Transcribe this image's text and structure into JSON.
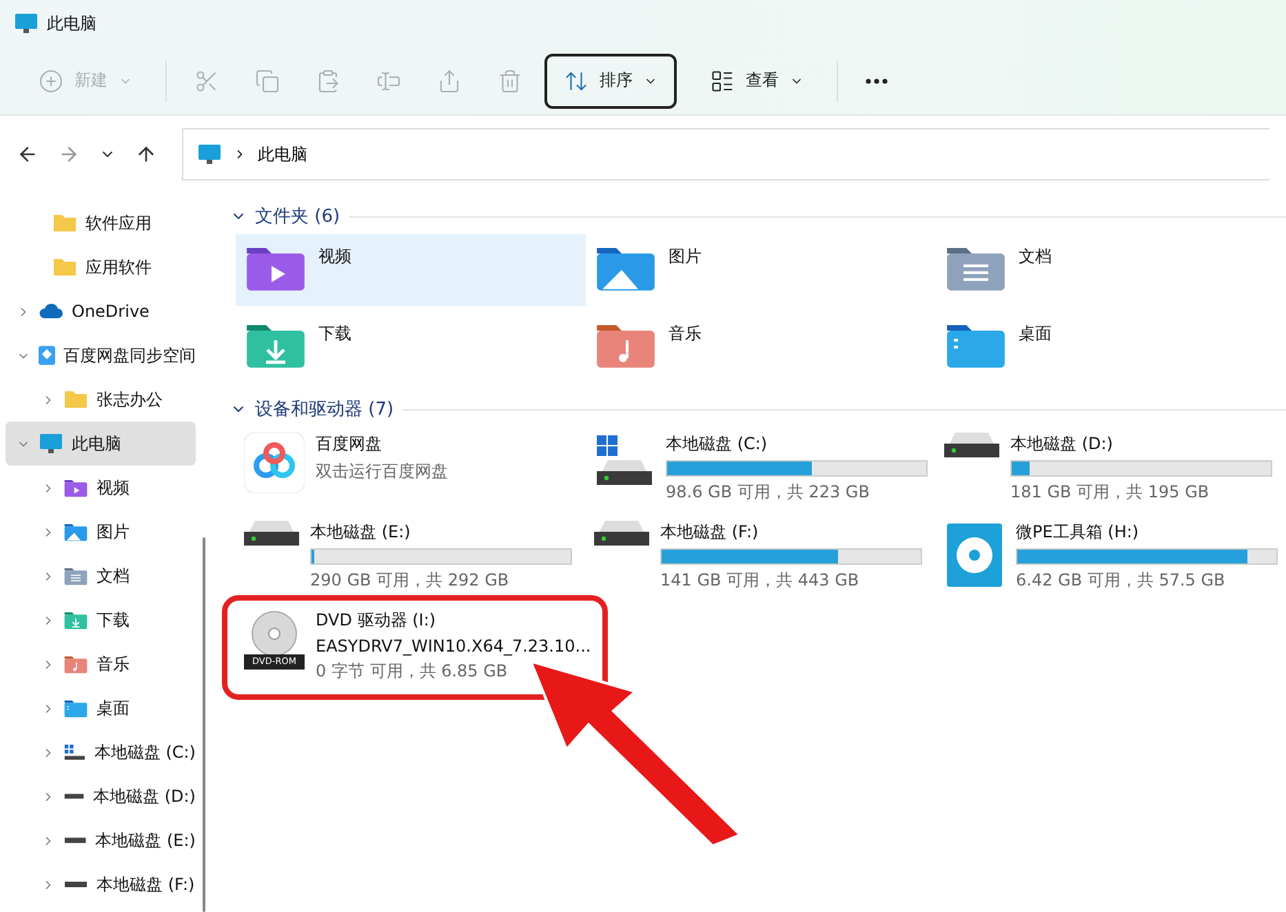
{
  "window": {
    "title": "此电脑"
  },
  "toolbar": [
    {
      "kind": "new",
      "label": "新建",
      "disabled": true,
      "selected": false
    },
    {
      "kind": "cut",
      "disabled": true,
      "selected": false
    },
    {
      "kind": "copy",
      "disabled": true,
      "selected": false
    },
    {
      "kind": "paste",
      "disabled": true,
      "selected": false
    },
    {
      "kind": "rename",
      "disabled": true,
      "selected": false
    },
    {
      "kind": "share",
      "disabled": true,
      "selected": false
    },
    {
      "kind": "delete",
      "disabled": true,
      "selected": false
    },
    {
      "kind": "sort",
      "label": "排序",
      "disabled": false,
      "selected": true
    },
    {
      "kind": "view",
      "label": "查看",
      "disabled": false,
      "selected": false
    },
    {
      "kind": "more",
      "disabled": false,
      "selected": false
    }
  ],
  "address": {
    "path": [
      "此电脑"
    ]
  },
  "sidebar": {
    "continued_items": [
      {
        "label": "软件应用",
        "kind": "folder"
      },
      {
        "label": "应用软件",
        "kind": "folder"
      }
    ],
    "items": [
      {
        "label": "OneDrive",
        "kind": "cloud",
        "expanded": false,
        "selected": false
      },
      {
        "label": "百度网盘同步空间",
        "kind": "baidu",
        "expanded": true,
        "selected": false,
        "children": [
          {
            "label": "张志办公",
            "kind": "folder",
            "expanded": false,
            "selected": false
          }
        ]
      },
      {
        "label": "此电脑",
        "kind": "pc",
        "expanded": true,
        "selected": true,
        "children": [
          {
            "label": "视频",
            "kind": "video",
            "expanded": false,
            "selected": false
          },
          {
            "label": "图片",
            "kind": "pictures",
            "expanded": false,
            "selected": false
          },
          {
            "label": "文档",
            "kind": "documents",
            "expanded": false,
            "selected": false
          },
          {
            "label": "下载",
            "kind": "downloads",
            "expanded": false,
            "selected": false
          },
          {
            "label": "音乐",
            "kind": "music",
            "expanded": false,
            "selected": false
          },
          {
            "label": "桌面",
            "kind": "desktop",
            "expanded": false,
            "selected": false
          },
          {
            "label": "本地磁盘 (C:)",
            "kind": "windows-disk",
            "expanded": false,
            "selected": false
          },
          {
            "label": "本地磁盘 (D:)",
            "kind": "disk",
            "expanded": false,
            "selected": false
          },
          {
            "label": "本地磁盘 (E:)",
            "kind": "disk",
            "expanded": false,
            "selected": false
          },
          {
            "label": "本地磁盘 (F:)",
            "kind": "disk",
            "expanded": false,
            "selected": false
          }
        ]
      }
    ]
  },
  "folders": {
    "heading": "文件夹 (6)",
    "expanded": true,
    "items": [
      {
        "name": "视频",
        "kind": "video",
        "selected": true
      },
      {
        "name": "图片",
        "kind": "pictures",
        "selected": false
      },
      {
        "name": "文档",
        "kind": "documents",
        "selected": false
      },
      {
        "name": "下载",
        "kind": "downloads",
        "selected": false
      },
      {
        "name": "音乐",
        "kind": "music",
        "selected": false
      },
      {
        "name": "桌面",
        "kind": "desktop",
        "selected": false
      }
    ]
  },
  "drives": {
    "heading": "设备和驱动器 (7)",
    "expanded": true,
    "items": [
      {
        "kind": "app",
        "name": "百度网盘",
        "subtitle": "双击运行百度网盘",
        "highlighted": false
      },
      {
        "kind": "windows-disk",
        "name": "本地磁盘 (C:)",
        "level": 0.56,
        "space": "98.6 GB 可用，共 223 GB",
        "highlighted": false
      },
      {
        "kind": "disk",
        "name": "本地磁盘 (D:)",
        "level": 0.07,
        "space": "181 GB 可用，共 195 GB",
        "highlighted": false
      },
      {
        "kind": "disk",
        "name": "本地磁盘 (E:)",
        "level": 0.01,
        "space": "290 GB 可用，共 292 GB",
        "highlighted": false
      },
      {
        "kind": "disk",
        "name": "本地磁盘 (F:)",
        "level": 0.68,
        "space": "141 GB 可用，共 443 GB",
        "highlighted": false
      },
      {
        "kind": "usb",
        "name": "微PE工具箱 (H:)",
        "level": 0.89,
        "space": "6.42 GB 可用，共 57.5 GB",
        "highlighted": false
      },
      {
        "kind": "dvd",
        "name": "DVD 驱动器 (I:)",
        "icon_label": "DVD-ROM",
        "volume": "EASYDRV7_WIN10.X64_7.23.10...",
        "space": "0 字节 可用，共 6.85 GB",
        "highlighted": true
      }
    ]
  },
  "annotation": {
    "arrow": true
  }
}
